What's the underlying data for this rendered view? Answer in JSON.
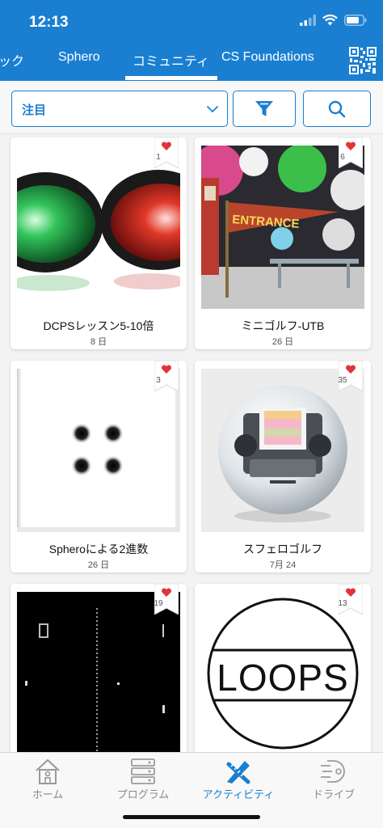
{
  "status_bar": {
    "time": "12:13"
  },
  "tabs": [
    {
      "label": "ック",
      "active": false
    },
    {
      "label": "Sphero",
      "active": false
    },
    {
      "label": "コミュニティ",
      "active": true
    },
    {
      "label": "CS Foundations",
      "active": false
    }
  ],
  "filter": {
    "selected": "注目"
  },
  "colors": {
    "accent": "#1a7fd1",
    "heart": "#e0343a"
  },
  "cards": [
    {
      "title": "DCPSレッスン5-10倍",
      "date": "8 日",
      "likes": "1",
      "image": "traffic-lights-icon"
    },
    {
      "title": "ミニゴルフ-UTB",
      "date": "26 日",
      "likes": "6",
      "image": "entrance-photo"
    },
    {
      "title": "Spheroによる2進数",
      "date": "26 日",
      "likes": "3",
      "image": "dots-matrix"
    },
    {
      "title": "スフェロゴルフ",
      "date": "7月 24",
      "likes": "35",
      "image": "sphero-bolt-photo"
    },
    {
      "title": "",
      "date": "",
      "likes": "19",
      "image": "pong-game"
    },
    {
      "title": "",
      "date": "",
      "likes": "13",
      "image": "loops-logo"
    }
  ],
  "loops_text": "LOOPS",
  "entrance_text": "ENTRANCE",
  "nav": [
    {
      "label": "ホーム",
      "icon": "home-icon",
      "active": false
    },
    {
      "label": "プログラム",
      "icon": "program-icon",
      "active": false
    },
    {
      "label": "アクティビティ",
      "icon": "activity-icon",
      "active": true
    },
    {
      "label": "ドライブ",
      "icon": "drive-icon",
      "active": false
    }
  ]
}
